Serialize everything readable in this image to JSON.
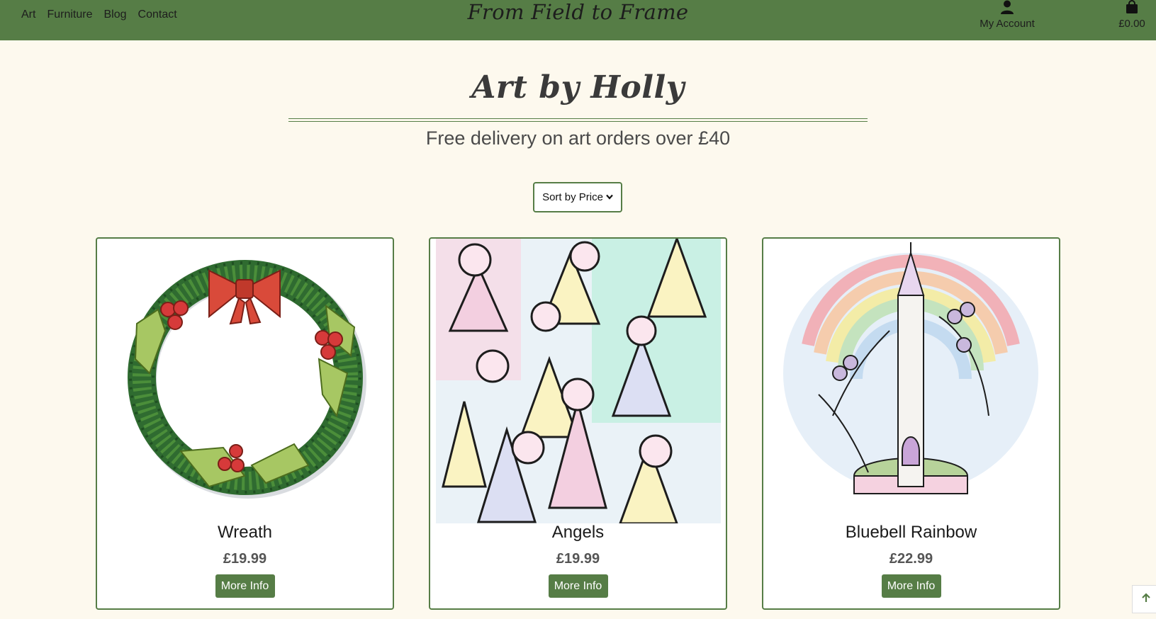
{
  "nav": {
    "links": [
      "Art",
      "Furniture",
      "Blog",
      "Contact"
    ],
    "brand": "From Field to Frame",
    "account_label": "My Account",
    "account_icon": "user-icon",
    "cart_total": "£0.00",
    "cart_icon": "shopping-bag-icon"
  },
  "header": {
    "title": "Art by Holly",
    "subtitle": "Free delivery on art orders over £40"
  },
  "sort": {
    "label": "Sort by Price",
    "icon": "chevron-down-icon"
  },
  "products": [
    {
      "name": "Wreath",
      "price": "£19.99",
      "button": "More Info"
    },
    {
      "name": "Angels",
      "price": "£19.99",
      "button": "More Info"
    },
    {
      "name": "Bluebell Rainbow",
      "price": "£22.99",
      "button": "More Info"
    }
  ],
  "back_to_top_icon": "arrow-up-icon",
  "colors": {
    "brand": "#567d46",
    "page_bg": "#fdf9ee"
  }
}
